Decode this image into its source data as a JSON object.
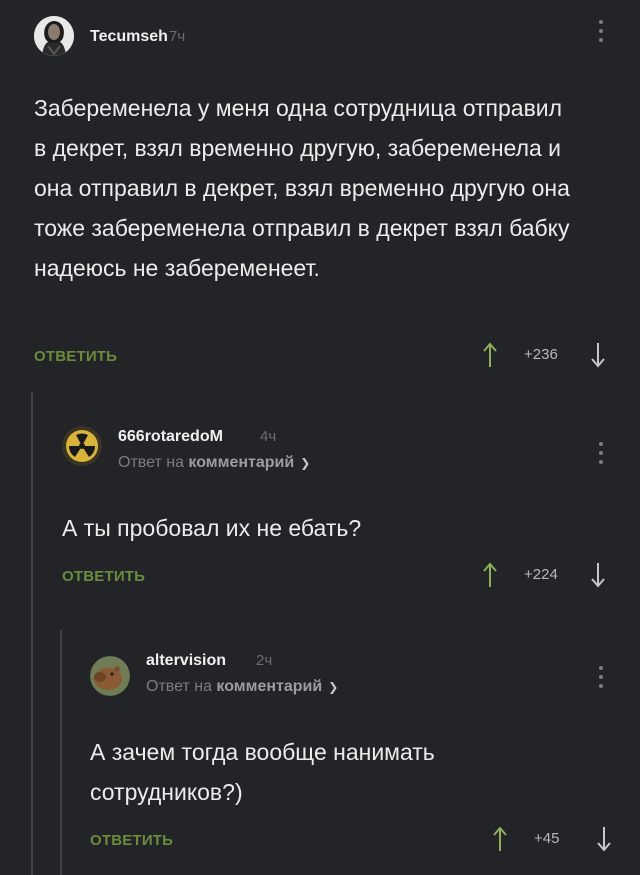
{
  "comments": [
    {
      "username": "Tecumseh",
      "time": "7ч",
      "text": "Забеременела у меня одна сотрудница отправил в декрет, взял временно другую, забеременела и она отправил в декрет, взял временно другую она тоже забеременела отправил в декрет взял бабку надеюсь не забеременеет.",
      "reply_label": "ОТВЕТИТЬ",
      "score": "+236",
      "avatar_icon": "man-portrait-avatar"
    },
    {
      "username": "666rotaredoM",
      "time": "4ч",
      "reply_prefix": "Ответ на",
      "reply_target": "комментарий",
      "text": "А ты пробовал их не ебать?",
      "reply_label": "ОТВЕТИТЬ",
      "score": "+224",
      "avatar_icon": "radiation-hazard-avatar"
    },
    {
      "username": "altervision",
      "time": "2ч",
      "reply_prefix": "Ответ на",
      "reply_target": "комментарий",
      "text": "А зачем тогда вообще нанимать сотрудников?)",
      "reply_label": "ОТВЕТИТЬ",
      "score": "+45",
      "avatar_icon": "capybara-avatar"
    }
  ],
  "colors": {
    "background": "#222427",
    "reply_button": "#6b8c3c",
    "thread_line": "#3e4145"
  }
}
